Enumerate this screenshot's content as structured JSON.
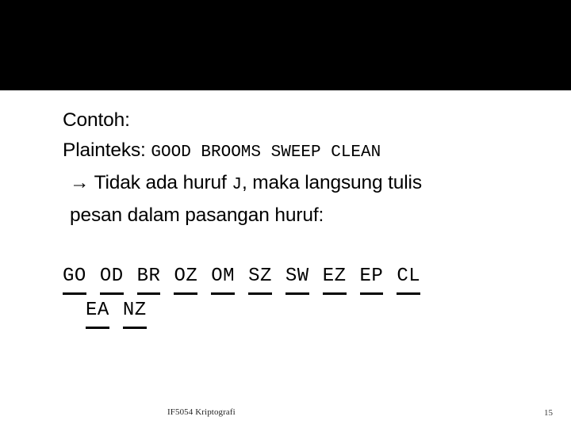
{
  "slide": {
    "top_band_color": "#000000",
    "background_color": "#ffffff",
    "text_color": "#000000",
    "content": {
      "heading": "Contoh:",
      "plaintext_label": "Plainteks:",
      "plaintext_value": "GOOD  BROOMS  SWEEP  CLEAN",
      "note_arrow": "→",
      "note_part1": " Tidak ada huruf ",
      "note_letter": "J",
      "note_part2": ", maka langsung tulis",
      "note_line2": "pesan dalam pasangan huruf:"
    },
    "pairs": {
      "row1": [
        "GO",
        "OD",
        "BR",
        "OZ",
        "OM",
        "SZ",
        "SW",
        "EZ",
        "EP",
        "CL"
      ],
      "row2": [
        "EA",
        "NZ"
      ]
    },
    "footer": {
      "note": "IF5054 Kriptografi",
      "page_number": "15"
    }
  }
}
